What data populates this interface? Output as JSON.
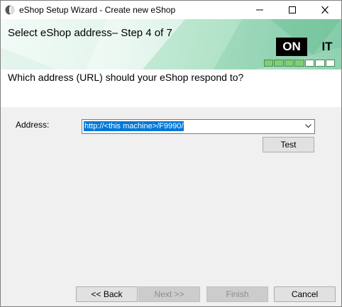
{
  "window": {
    "title": "eShop Setup Wizard - Create new eShop"
  },
  "banner": {
    "step_title": "Select eShop address– Step 4 of 7",
    "logo_left": "ON",
    "logo_right": "IT",
    "progress": {
      "total_steps": 7,
      "completed_steps": 4
    }
  },
  "question": "Which address (URL) should your eShop respond to?",
  "address": {
    "label": "Address:",
    "value": "http://<this machine>/F9990/"
  },
  "buttons": {
    "test": "Test",
    "back": "<< Back",
    "next": "Next >>",
    "finish": "Finish",
    "cancel": "Cancel"
  },
  "colors": {
    "selection": "#0078d7",
    "progress_fill": "#7fd073"
  }
}
